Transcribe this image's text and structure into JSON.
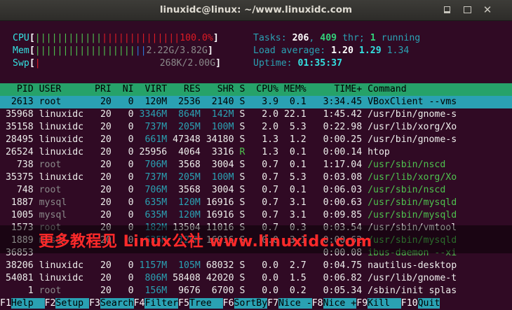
{
  "window": {
    "title": "linuxidc@linux: ~/www.linuxidc.com"
  },
  "meters": {
    "cpu": {
      "label": "CPU",
      "bar_green": "||||||||||||",
      "bar_red": "||||||||||||||",
      "value": "100.0%"
    },
    "mem": {
      "label": "Mem",
      "bar_green": "||||||||||||||||||",
      "bar_blue": "||",
      "value": "2.22G/3.82G"
    },
    "swp": {
      "label": "Swp",
      "bar_red": "|",
      "value": "268K/2.00G"
    }
  },
  "stats": {
    "tasks_label": "Tasks: ",
    "tasks": "206",
    "threads": "409",
    "thr_label": " thr; ",
    "running": "1",
    "running_label": " running",
    "load_label": "Load average: ",
    "load1": "1.20",
    "load5": "1.29",
    "load15": "1.34",
    "uptime_label": "Uptime: ",
    "uptime": "01:35:37"
  },
  "columns": [
    "PID",
    "USER",
    "PRI",
    "NI",
    "VIRT",
    "RES",
    "SHR",
    "S",
    "CPU%",
    "MEM%",
    "TIME+",
    "Command"
  ],
  "processes": [
    {
      "pid": "2613",
      "user": "root",
      "pri": "20",
      "ni": "0",
      "virt": "120M",
      "res": "2536",
      "shr": "2140",
      "s": "S",
      "cpu": "3.9",
      "mem": "0.1",
      "time": "3:34.45",
      "cmd": "VBoxClient --vms"
    },
    {
      "pid": "35968",
      "user": "linuxidc",
      "pri": "20",
      "ni": "0",
      "virt": "3346M",
      "res": "864M",
      "shr": "142M",
      "s": "S",
      "cpu": "2.0",
      "mem": "22.1",
      "time": "1:45.42",
      "cmd": "/usr/bin/gnome-s"
    },
    {
      "pid": "35158",
      "user": "linuxidc",
      "pri": "20",
      "ni": "0",
      "virt": "737M",
      "res": "205M",
      "shr": "100M",
      "s": "S",
      "cpu": "2.0",
      "mem": "5.3",
      "time": "0:22.98",
      "cmd": "/usr/lib/xorg/Xo"
    },
    {
      "pid": "28495",
      "user": "linuxidc",
      "pri": "20",
      "ni": "0",
      "virt": "661M",
      "res": "47348",
      "shr": "34180",
      "s": "S",
      "cpu": "1.3",
      "mem": "1.2",
      "time": "0:00.25",
      "cmd": "/usr/bin/gnome-s"
    },
    {
      "pid": "26524",
      "user": "linuxidc",
      "pri": "20",
      "ni": "0",
      "virt": "25956",
      "res": "4064",
      "shr": "3316",
      "s": "R",
      "cpu": "1.3",
      "mem": "0.1",
      "time": "0:00.14",
      "cmd": "htop"
    },
    {
      "pid": "738",
      "user": "root",
      "pri": "20",
      "ni": "0",
      "virt": "706M",
      "res": "3568",
      "shr": "3004",
      "s": "S",
      "cpu": "0.7",
      "mem": "0.1",
      "time": "1:17.04",
      "cmd": "/usr/sbin/nscd"
    },
    {
      "pid": "35375",
      "user": "linuxidc",
      "pri": "20",
      "ni": "0",
      "virt": "737M",
      "res": "205M",
      "shr": "100M",
      "s": "S",
      "cpu": "0.7",
      "mem": "5.3",
      "time": "0:03.08",
      "cmd": "/usr/lib/xorg/Xo"
    },
    {
      "pid": "748",
      "user": "root",
      "pri": "20",
      "ni": "0",
      "virt": "706M",
      "res": "3568",
      "shr": "3004",
      "s": "S",
      "cpu": "0.7",
      "mem": "0.1",
      "time": "0:06.03",
      "cmd": "/usr/sbin/nscd"
    },
    {
      "pid": "1887",
      "user": "mysql",
      "pri": "20",
      "ni": "0",
      "virt": "635M",
      "res": "120M",
      "shr": "16916",
      "s": "S",
      "cpu": "0.7",
      "mem": "3.1",
      "time": "0:00.63",
      "cmd": "/usr/sbin/mysqld"
    },
    {
      "pid": "1005",
      "user": "mysql",
      "pri": "20",
      "ni": "0",
      "virt": "635M",
      "res": "120M",
      "shr": "16916",
      "s": "S",
      "cpu": "0.7",
      "mem": "3.1",
      "time": "0:09.85",
      "cmd": "/usr/sbin/mysqld"
    },
    {
      "pid": "1573",
      "user": "root",
      "pri": "20",
      "ni": "0",
      "virt": "182M",
      "res": "13504",
      "shr": "11016",
      "s": "S",
      "cpu": "0.7",
      "mem": "0.3",
      "time": "0:03.54",
      "cmd": "/usr/sbin/vmtool"
    },
    {
      "pid": "1889",
      "user": "mysql",
      "pri": "20",
      "ni": "0",
      "virt": "635M",
      "res": "120M",
      "shr": "16916",
      "s": "S",
      "cpu": "0.0",
      "mem": "3.1",
      "time": "0:00.62",
      "cmd": "/usr/sbin/mysqld"
    },
    {
      "pid": "36853",
      "user": "",
      "pri": "",
      "ni": "",
      "virt": "",
      "res": "",
      "shr": "",
      "s": "",
      "cpu": "",
      "mem": "",
      "time": "0:00.08",
      "cmd": "ibus-daemon --xi"
    },
    {
      "pid": "38206",
      "user": "linuxidc",
      "pri": "20",
      "ni": "0",
      "virt": "1157M",
      "res": "105M",
      "shr": "68032",
      "s": "S",
      "cpu": "0.0",
      "mem": "2.7",
      "time": "0:04.75",
      "cmd": "nautilus-desktop"
    },
    {
      "pid": "54081",
      "user": "linuxidc",
      "pri": "20",
      "ni": "0",
      "virt": "806M",
      "res": "58408",
      "shr": "42020",
      "s": "S",
      "cpu": "0.0",
      "mem": "1.5",
      "time": "0:06.82",
      "cmd": "/usr/lib/gnome-t"
    },
    {
      "pid": "1",
      "user": "root",
      "pri": "20",
      "ni": "0",
      "virt": "156M",
      "res": "9676",
      "shr": "6700",
      "s": "S",
      "cpu": "0.0",
      "mem": "0.2",
      "time": "0:05.34",
      "cmd": "/sbin/init splas"
    }
  ],
  "function_keys": [
    {
      "key": "F1",
      "label": "Help  "
    },
    {
      "key": "F2",
      "label": "Setup "
    },
    {
      "key": "F3",
      "label": "Search"
    },
    {
      "key": "F4",
      "label": "Filter"
    },
    {
      "key": "F5",
      "label": "Tree  "
    },
    {
      "key": "F6",
      "label": "SortBy"
    },
    {
      "key": "F7",
      "label": "Nice -"
    },
    {
      "key": "F8",
      "label": "Nice +"
    },
    {
      "key": "F9",
      "label": "Kill  "
    },
    {
      "key": "F10",
      "label": "Quit"
    }
  ],
  "watermark": {
    "text": "更多教程见 Linux公社 www.linuxidc.com"
  },
  "colors": {
    "terminal_bg": "#300a24",
    "header_bg": "#26a269",
    "selection_bg": "#2aa1b3",
    "cyan": "#34e2e2",
    "green": "#33d17a",
    "red": "#e01b24",
    "blue": "#2a7bde"
  }
}
